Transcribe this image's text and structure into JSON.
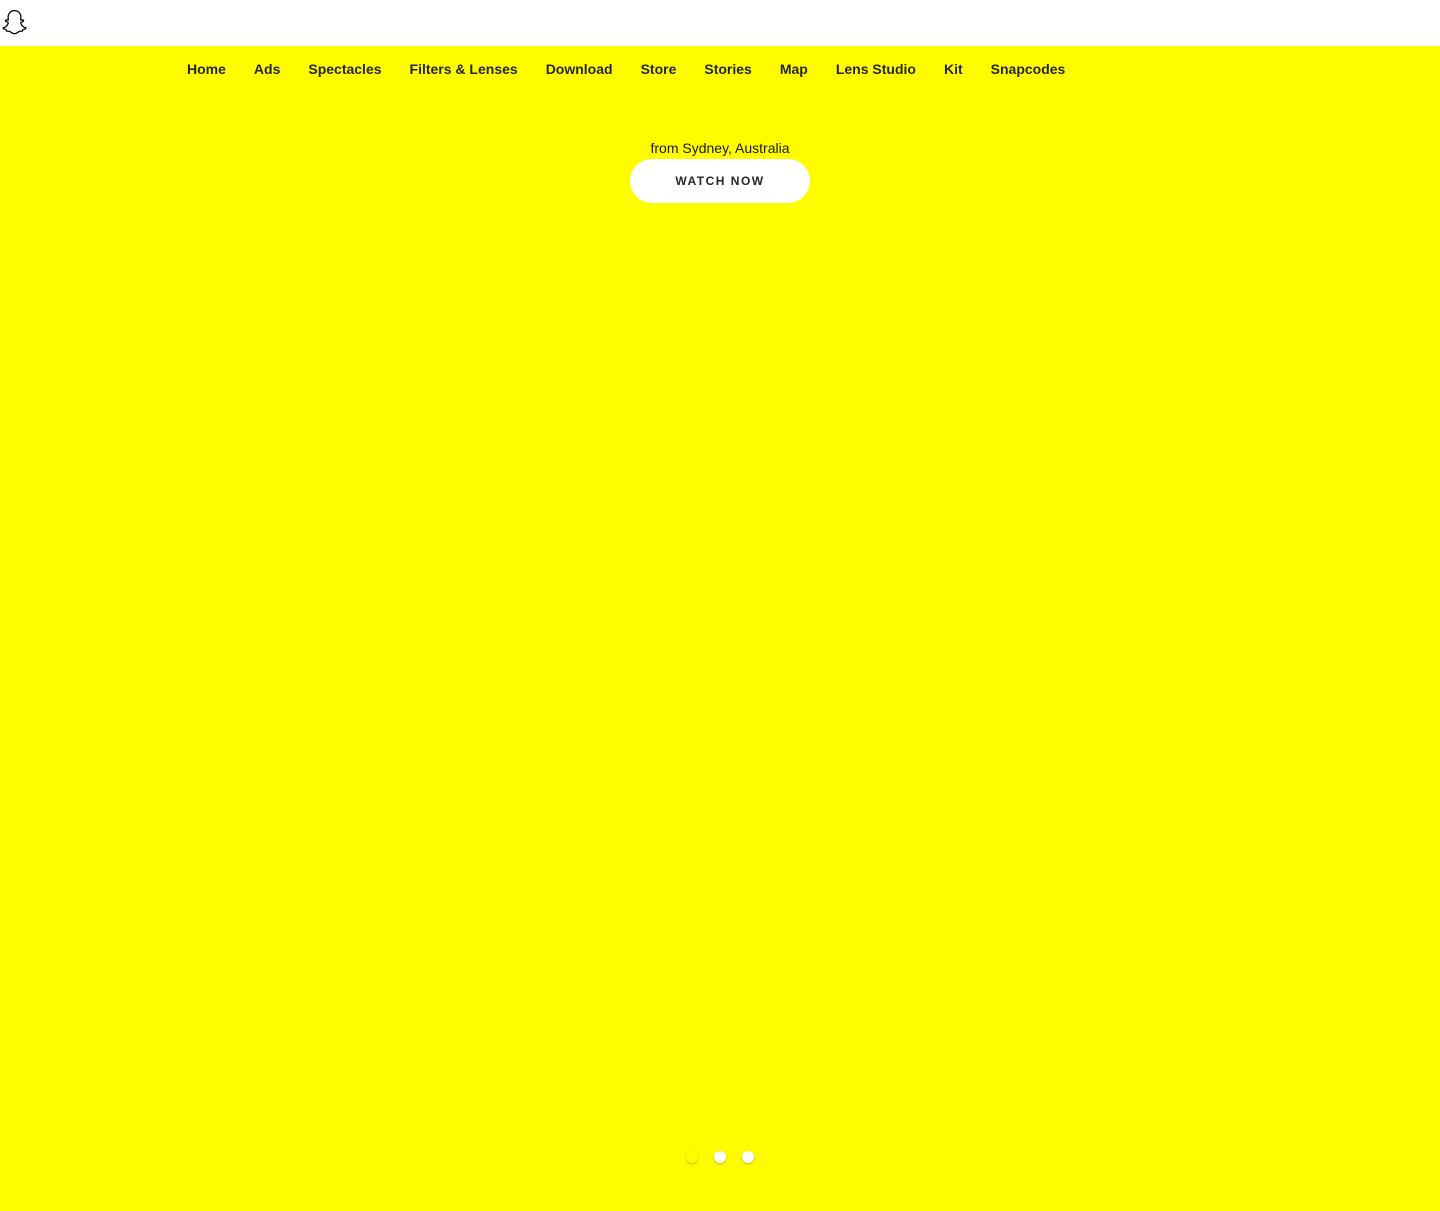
{
  "brand": {
    "logo_icon": "snapchat-ghost-icon",
    "accent_color": "#FFFC00"
  },
  "nav": {
    "items": [
      {
        "label": "Home"
      },
      {
        "label": "Ads"
      },
      {
        "label": "Spectacles"
      },
      {
        "label": "Filters & Lenses"
      },
      {
        "label": "Download"
      },
      {
        "label": "Store"
      },
      {
        "label": "Stories"
      },
      {
        "label": "Map"
      },
      {
        "label": "Lens Studio"
      },
      {
        "label": "Kit"
      },
      {
        "label": "Snapcodes"
      }
    ]
  },
  "hero": {
    "location_text": "from Sydney, Australia",
    "cta_label": "WATCH NOW"
  },
  "carousel": {
    "active_index": 0,
    "dot_count": 3
  }
}
